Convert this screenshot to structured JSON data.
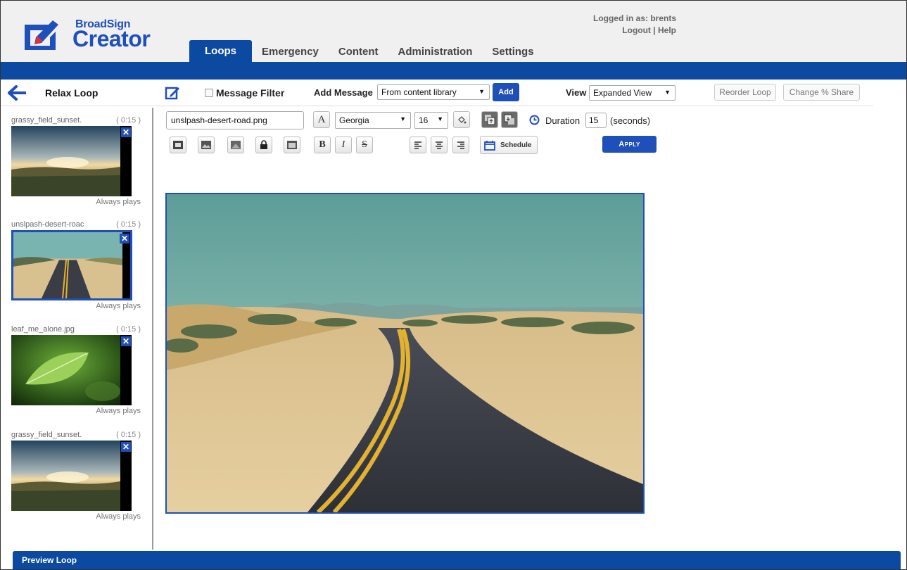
{
  "brand": {
    "name_small": "BroadSign",
    "name_big": "Creator",
    "color": "#1f4fb8"
  },
  "session": {
    "logged_in": "Logged in as: brents",
    "logout": "Logout",
    "sep": "|",
    "help": "Help"
  },
  "nav": {
    "tabs": [
      "Loops",
      "Emergency",
      "Content",
      "Administration",
      "Settings"
    ],
    "active": "Loops"
  },
  "toolbar": {
    "loop_name": "Relax Loop",
    "message_filter_label": "Message Filter",
    "add_message_label": "Add Message",
    "add_source": "From content library",
    "add_button": "Add",
    "view_label": "View",
    "view_value": "Expanded View",
    "reorder_button": "Reorder Loop",
    "share_button": "Change % Share"
  },
  "messages": [
    {
      "name": "grassy_field_sunset.",
      "duration": "( 0:15 )",
      "plays": "Always plays",
      "thumb": "sunset"
    },
    {
      "name": "unslpash-desert-roac",
      "duration": "( 0:15 )",
      "plays": "Always plays",
      "thumb": "road",
      "selected": true
    },
    {
      "name": "leaf_me_alone.jpg",
      "duration": "( 0:15 )",
      "plays": "Always plays",
      "thumb": "leaf"
    },
    {
      "name": "grassy_field_sunset.",
      "duration": "( 0:15 )",
      "plays": "Always plays",
      "thumb": "sunset"
    }
  ],
  "editor": {
    "filename": "unslpash-desert-road.png",
    "font": "Georgia",
    "font_size": "16",
    "duration_label": "Duration",
    "duration_value": "15",
    "duration_unit": "(seconds)",
    "schedule_label": "Schedule",
    "apply_label": "Apply",
    "bold": "B",
    "italic": "I",
    "strike": "S",
    "font_icon": "A"
  },
  "footer": {
    "preview_label": "Preview Loop"
  },
  "colors": {
    "primary": "#0b4aa0",
    "accent": "#1f4fb8"
  }
}
